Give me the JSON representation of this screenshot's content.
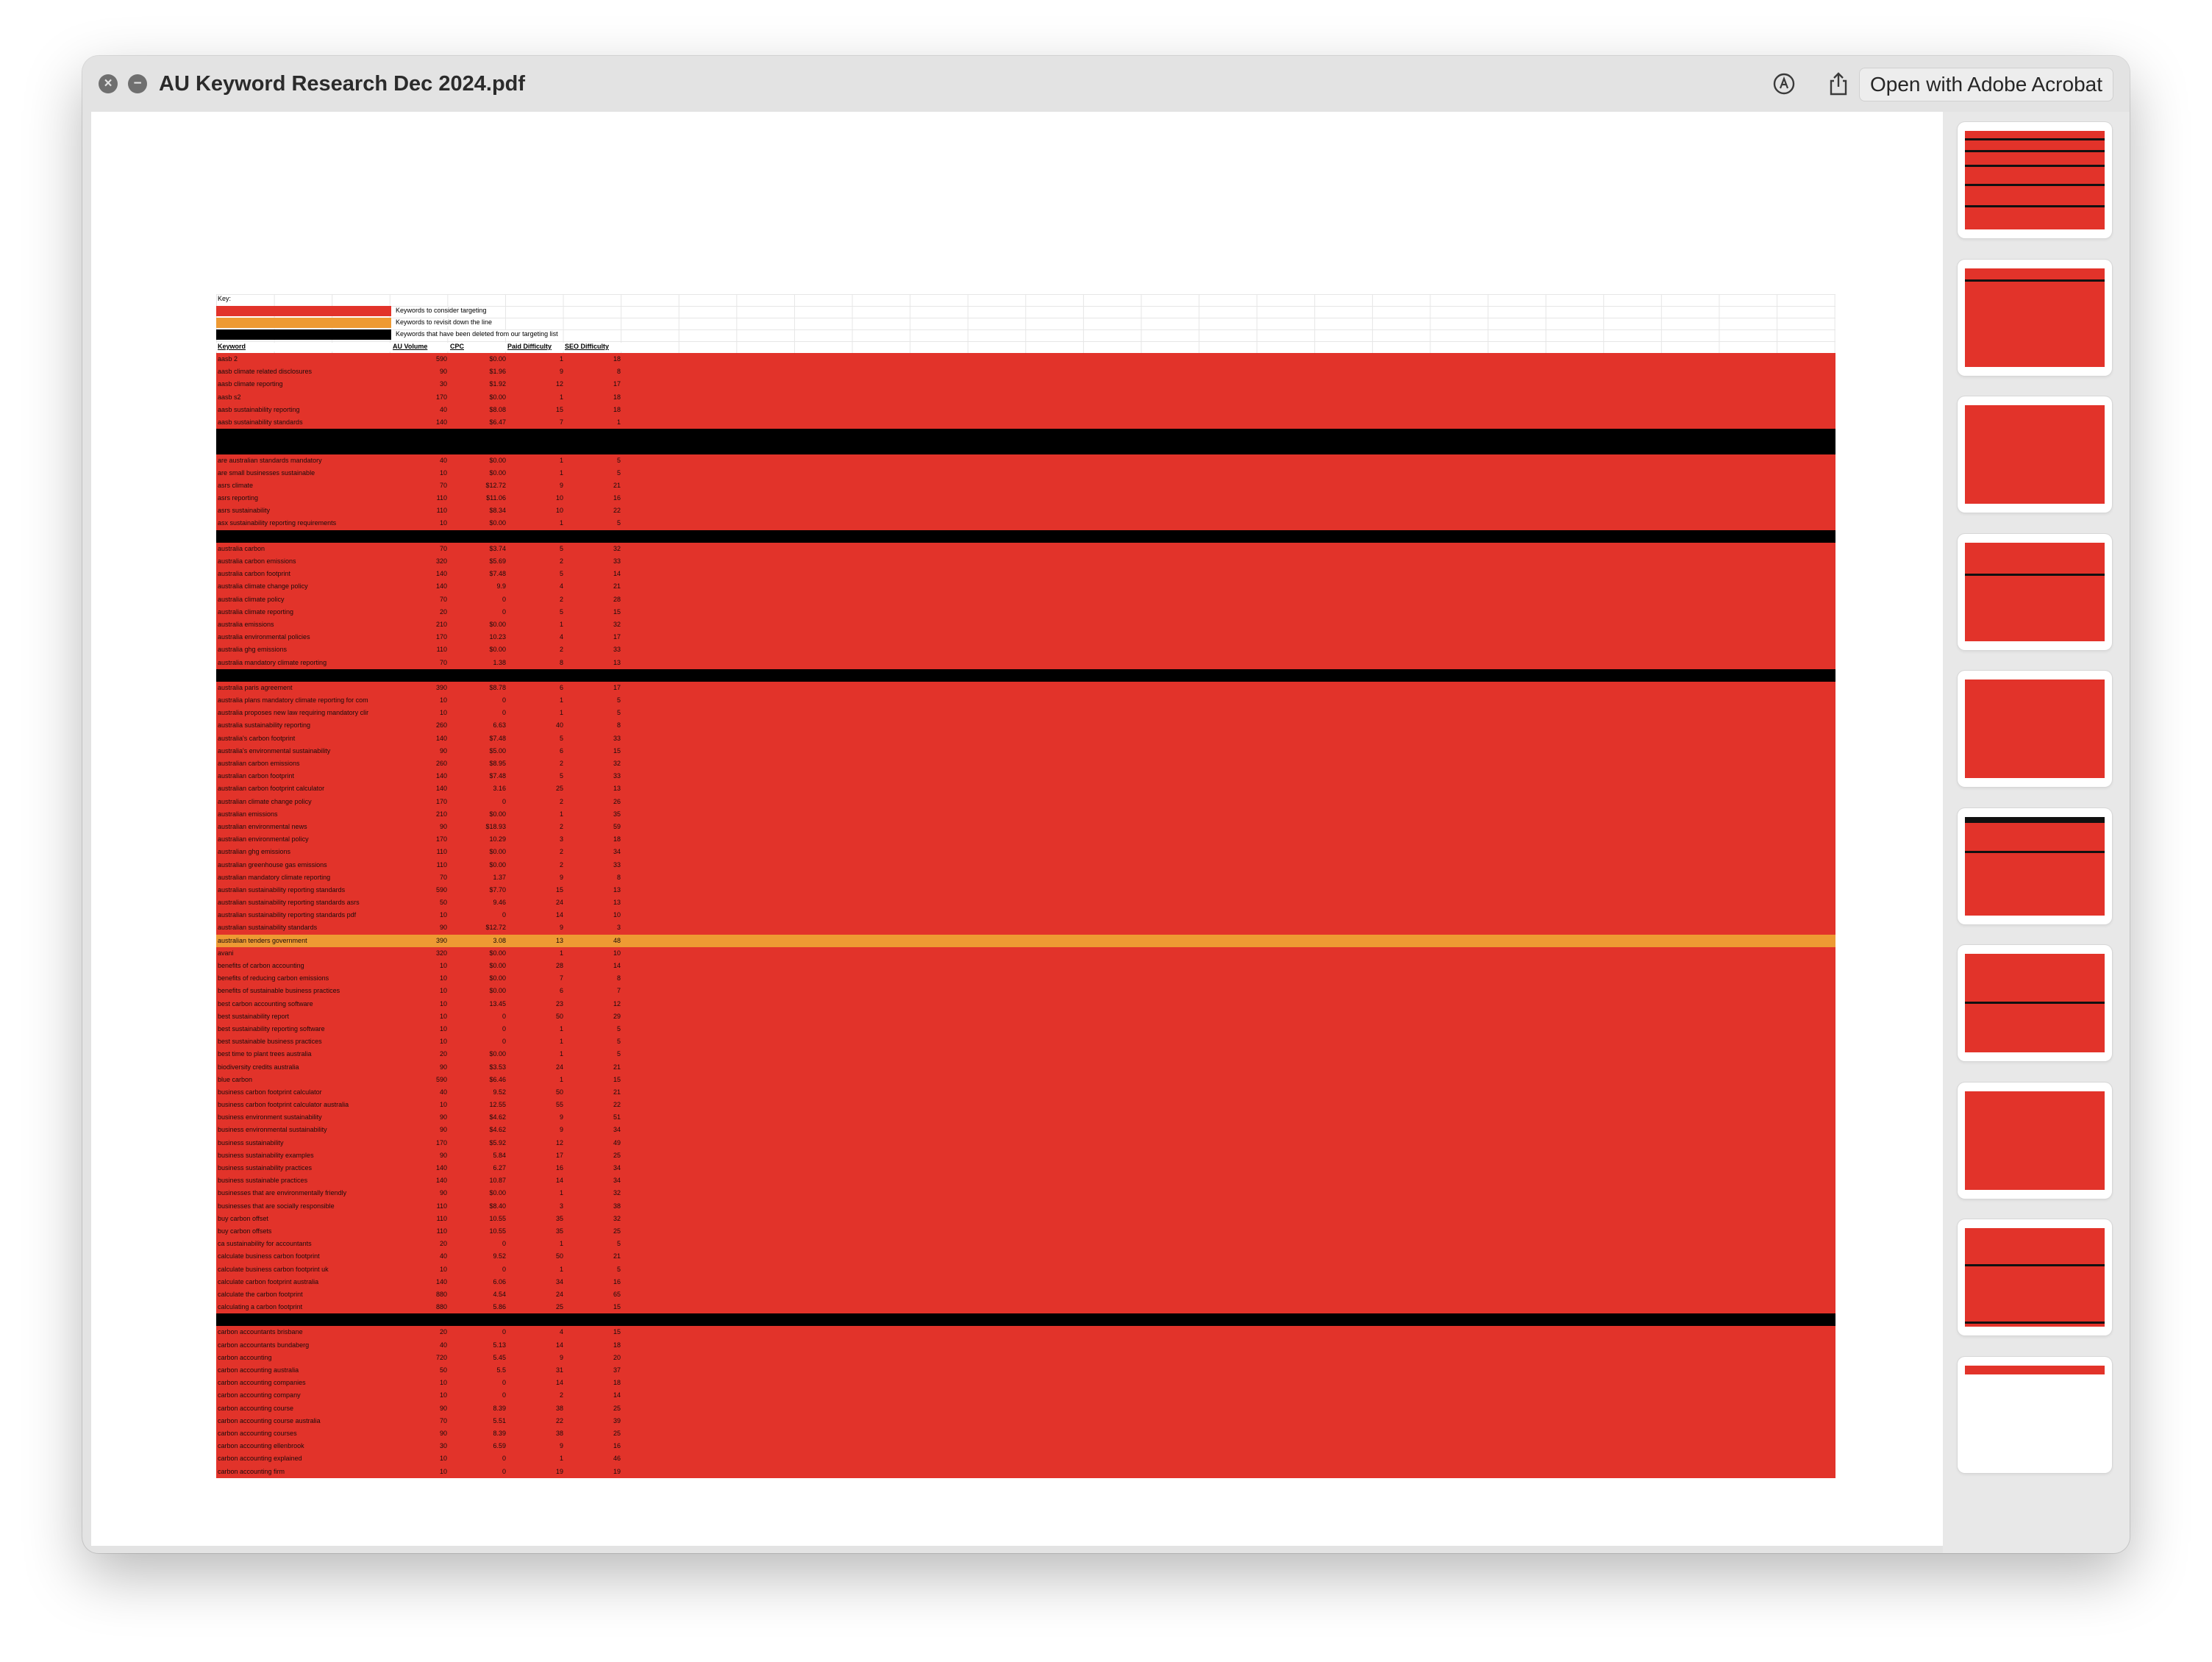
{
  "window": {
    "title": "AU Keyword Research Dec 2024.pdf",
    "open_button": "Open with Adobe Acrobat",
    "close_icon": "close-icon",
    "minimize_icon": "minus-circle-icon",
    "markup_icon": "markup-pen-icon",
    "share_icon": "share-icon"
  },
  "colors": {
    "red": "#e2332a",
    "orange": "#ee9a33",
    "black": "#000000"
  },
  "sheet": {
    "key_title": "Key:",
    "key": [
      {
        "color": "red",
        "label": "Keywords to consider targeting"
      },
      {
        "color": "orange",
        "label": "Keywords to revisit down the line"
      },
      {
        "color": "black",
        "label": "Keywords that have been deleted from our targeting list"
      }
    ],
    "headers": [
      "Keyword",
      "AU Volume",
      "CPC",
      "Paid Difficulty",
      "SEO Difficulty"
    ],
    "rows": [
      [
        "red",
        "aasb 2",
        "590",
        "$0.00",
        "1",
        "18"
      ],
      [
        "red",
        "aasb climate related disclosures",
        "90",
        "$1.96",
        "9",
        "8"
      ],
      [
        "red",
        "aasb climate reporting",
        "30",
        "$1.92",
        "12",
        "17"
      ],
      [
        "red",
        "aasb s2",
        "170",
        "$0.00",
        "1",
        "18"
      ],
      [
        "red",
        "aasb sustainability reporting",
        "40",
        "$8.08",
        "15",
        "18"
      ],
      [
        "red",
        "aasb sustainability standards",
        "140",
        "$6.47",
        "7",
        "1"
      ],
      [
        "black",
        "",
        "",
        "",
        "",
        ""
      ],
      [
        "black",
        "",
        "",
        "",
        "",
        ""
      ],
      [
        "red",
        "are australian standards mandatory",
        "40",
        "$0.00",
        "1",
        "5"
      ],
      [
        "red",
        "are small businesses sustainable",
        "10",
        "$0.00",
        "1",
        "5"
      ],
      [
        "red",
        "asrs climate",
        "70",
        "$12.72",
        "9",
        "21"
      ],
      [
        "red",
        "asrs reporting",
        "110",
        "$11.06",
        "10",
        "16"
      ],
      [
        "red",
        "asrs sustainability",
        "110",
        "$8.34",
        "10",
        "22"
      ],
      [
        "red",
        "asx sustainability reporting requirements",
        "10",
        "$0.00",
        "1",
        "5"
      ],
      [
        "black",
        "",
        "",
        "",
        "",
        ""
      ],
      [
        "red",
        "australia carbon",
        "70",
        "$3.74",
        "5",
        "32"
      ],
      [
        "red",
        "australia carbon emissions",
        "320",
        "$5.69",
        "2",
        "33"
      ],
      [
        "red",
        "australia carbon footprint",
        "140",
        "$7.48",
        "5",
        "14"
      ],
      [
        "red",
        "australia climate change policy",
        "140",
        "9.9",
        "4",
        "21"
      ],
      [
        "red",
        "australia climate policy",
        "70",
        "0",
        "2",
        "28"
      ],
      [
        "red",
        "australia climate reporting",
        "20",
        "0",
        "5",
        "15"
      ],
      [
        "red",
        "australia emissions",
        "210",
        "$0.00",
        "1",
        "32"
      ],
      [
        "red",
        "australia environmental policies",
        "170",
        "10.23",
        "4",
        "17"
      ],
      [
        "red",
        "australia ghg emissions",
        "110",
        "$0.00",
        "2",
        "33"
      ],
      [
        "red",
        "australia mandatory climate reporting",
        "70",
        "1.38",
        "8",
        "13"
      ],
      [
        "black",
        "",
        "",
        "",
        "",
        ""
      ],
      [
        "red",
        "australia paris agreement",
        "390",
        "$8.78",
        "6",
        "17"
      ],
      [
        "red",
        "australia plans mandatory climate reporting for com",
        "10",
        "0",
        "1",
        "5"
      ],
      [
        "red",
        "australia proposes new law requiring mandatory clir",
        "10",
        "0",
        "1",
        "5"
      ],
      [
        "red",
        "australia sustainability reporting",
        "260",
        "6.63",
        "40",
        "8"
      ],
      [
        "red",
        "australia's carbon footprint",
        "140",
        "$7.48",
        "5",
        "33"
      ],
      [
        "red",
        "australia's environmental sustainability",
        "90",
        "$5.00",
        "6",
        "15"
      ],
      [
        "red",
        "australian carbon emissions",
        "260",
        "$8.95",
        "2",
        "32"
      ],
      [
        "red",
        "australian carbon footprint",
        "140",
        "$7.48",
        "5",
        "33"
      ],
      [
        "red",
        "australian carbon footprint calculator",
        "140",
        "3.16",
        "25",
        "13"
      ],
      [
        "red",
        "australian climate change policy",
        "170",
        "0",
        "2",
        "26"
      ],
      [
        "red",
        "australian emissions",
        "210",
        "$0.00",
        "1",
        "35"
      ],
      [
        "red",
        "australian environmental news",
        "90",
        "$18.93",
        "2",
        "59"
      ],
      [
        "red",
        "australian environmental policy",
        "170",
        "10.29",
        "3",
        "18"
      ],
      [
        "red",
        "australian ghg emissions",
        "110",
        "$0.00",
        "2",
        "34"
      ],
      [
        "red",
        "australian greenhouse gas emissions",
        "110",
        "$0.00",
        "2",
        "33"
      ],
      [
        "red",
        "australian mandatory climate reporting",
        "70",
        "1.37",
        "9",
        "8"
      ],
      [
        "red",
        "australian sustainability reporting standards",
        "590",
        "$7.70",
        "15",
        "13"
      ],
      [
        "red",
        "australian sustainability reporting standards asrs",
        "50",
        "9.46",
        "24",
        "13"
      ],
      [
        "red",
        "australian sustainability reporting standards pdf",
        "10",
        "0",
        "14",
        "10"
      ],
      [
        "red",
        "australian sustainability standards",
        "90",
        "$12.72",
        "9",
        "3"
      ],
      [
        "orange",
        "australian tenders government",
        "390",
        "3.08",
        "13",
        "48"
      ],
      [
        "red",
        "avani",
        "320",
        "$0.00",
        "1",
        "10"
      ],
      [
        "red",
        "benefits of carbon accounting",
        "10",
        "$0.00",
        "28",
        "14"
      ],
      [
        "red",
        "benefits of reducing carbon emissions",
        "10",
        "$0.00",
        "7",
        "8"
      ],
      [
        "red",
        "benefits of sustainable business practices",
        "10",
        "$0.00",
        "6",
        "7"
      ],
      [
        "red",
        "best carbon accounting software",
        "10",
        "13.45",
        "23",
        "12"
      ],
      [
        "red",
        "best sustainability report",
        "10",
        "0",
        "50",
        "29"
      ],
      [
        "red",
        "best sustainability reporting software",
        "10",
        "0",
        "1",
        "5"
      ],
      [
        "red",
        "best sustainable business practices",
        "10",
        "0",
        "1",
        "5"
      ],
      [
        "red",
        "best time to plant trees australia",
        "20",
        "$0.00",
        "1",
        "5"
      ],
      [
        "red",
        "biodiversity credits australia",
        "90",
        "$3.53",
        "24",
        "21"
      ],
      [
        "red",
        "blue carbon",
        "590",
        "$6.46",
        "1",
        "15"
      ],
      [
        "red",
        "business carbon footprint calculator",
        "40",
        "9.52",
        "50",
        "21"
      ],
      [
        "red",
        "business carbon footprint calculator australia",
        "10",
        "12.55",
        "55",
        "22"
      ],
      [
        "red",
        "business environment sustainability",
        "90",
        "$4.62",
        "9",
        "51"
      ],
      [
        "red",
        "business environmental sustainability",
        "90",
        "$4.62",
        "9",
        "34"
      ],
      [
        "red",
        "business sustainability",
        "170",
        "$5.92",
        "12",
        "49"
      ],
      [
        "red",
        "business sustainability examples",
        "90",
        "5.84",
        "17",
        "25"
      ],
      [
        "red",
        "business sustainability practices",
        "140",
        "6.27",
        "16",
        "34"
      ],
      [
        "red",
        "business sustainable practices",
        "140",
        "10.87",
        "14",
        "34"
      ],
      [
        "red",
        "businesses that are environmentally friendly",
        "90",
        "$0.00",
        "1",
        "32"
      ],
      [
        "red",
        "businesses that are socially responsible",
        "110",
        "$8.40",
        "3",
        "38"
      ],
      [
        "red",
        "buy carbon offset",
        "110",
        "10.55",
        "35",
        "32"
      ],
      [
        "red",
        "buy carbon offsets",
        "110",
        "10.55",
        "35",
        "25"
      ],
      [
        "red",
        "ca sustainability for accountants",
        "20",
        "0",
        "1",
        "5"
      ],
      [
        "red",
        "calculate business carbon footprint",
        "40",
        "9.52",
        "50",
        "21"
      ],
      [
        "red",
        "calculate business carbon footprint uk",
        "10",
        "0",
        "1",
        "5"
      ],
      [
        "red",
        "calculate carbon footprint australia",
        "140",
        "6.06",
        "34",
        "16"
      ],
      [
        "red",
        "calculate the carbon footprint",
        "880",
        "4.54",
        "24",
        "65"
      ],
      [
        "red",
        "calculating a carbon footprint",
        "880",
        "5.86",
        "25",
        "15"
      ],
      [
        "black",
        "",
        "",
        "",
        "",
        ""
      ],
      [
        "red",
        "carbon accountants brisbane",
        "20",
        "0",
        "4",
        "15"
      ],
      [
        "red",
        "carbon accountants bundaberg",
        "40",
        "5.13",
        "14",
        "18"
      ],
      [
        "red",
        "carbon accounting",
        "720",
        "5.45",
        "9",
        "20"
      ],
      [
        "red",
        "carbon accounting australia",
        "50",
        "5.5",
        "31",
        "37"
      ],
      [
        "red",
        "carbon accounting companies",
        "10",
        "0",
        "14",
        "18"
      ],
      [
        "red",
        "carbon accounting company",
        "10",
        "0",
        "2",
        "14"
      ],
      [
        "red",
        "carbon accounting course",
        "90",
        "8.39",
        "38",
        "25"
      ],
      [
        "red",
        "carbon accounting course australia",
        "70",
        "5.51",
        "22",
        "39"
      ],
      [
        "red",
        "carbon accounting courses",
        "90",
        "8.39",
        "38",
        "25"
      ],
      [
        "red",
        "carbon accounting ellenbrook",
        "30",
        "6.59",
        "9",
        "16"
      ],
      [
        "red",
        "carbon accounting explained",
        "10",
        "0",
        "1",
        "46"
      ],
      [
        "red",
        "carbon accounting firm",
        "10",
        "0",
        "19",
        "19"
      ]
    ]
  },
  "thumbnails": [
    {
      "bars": [
        0.08,
        0.2,
        0.35,
        0.55,
        0.78
      ]
    },
    {
      "bars": [
        0.12
      ]
    },
    {
      "bars": []
    },
    {
      "bars": [
        0.33
      ]
    },
    {
      "bars": []
    },
    {
      "bars": [
        0.0,
        0.02,
        0.04,
        0.36
      ]
    },
    {
      "bars": [
        0.5
      ]
    },
    {
      "bars": []
    },
    {
      "bars": [
        0.38,
        0.98
      ]
    },
    {
      "bars": []
    }
  ]
}
